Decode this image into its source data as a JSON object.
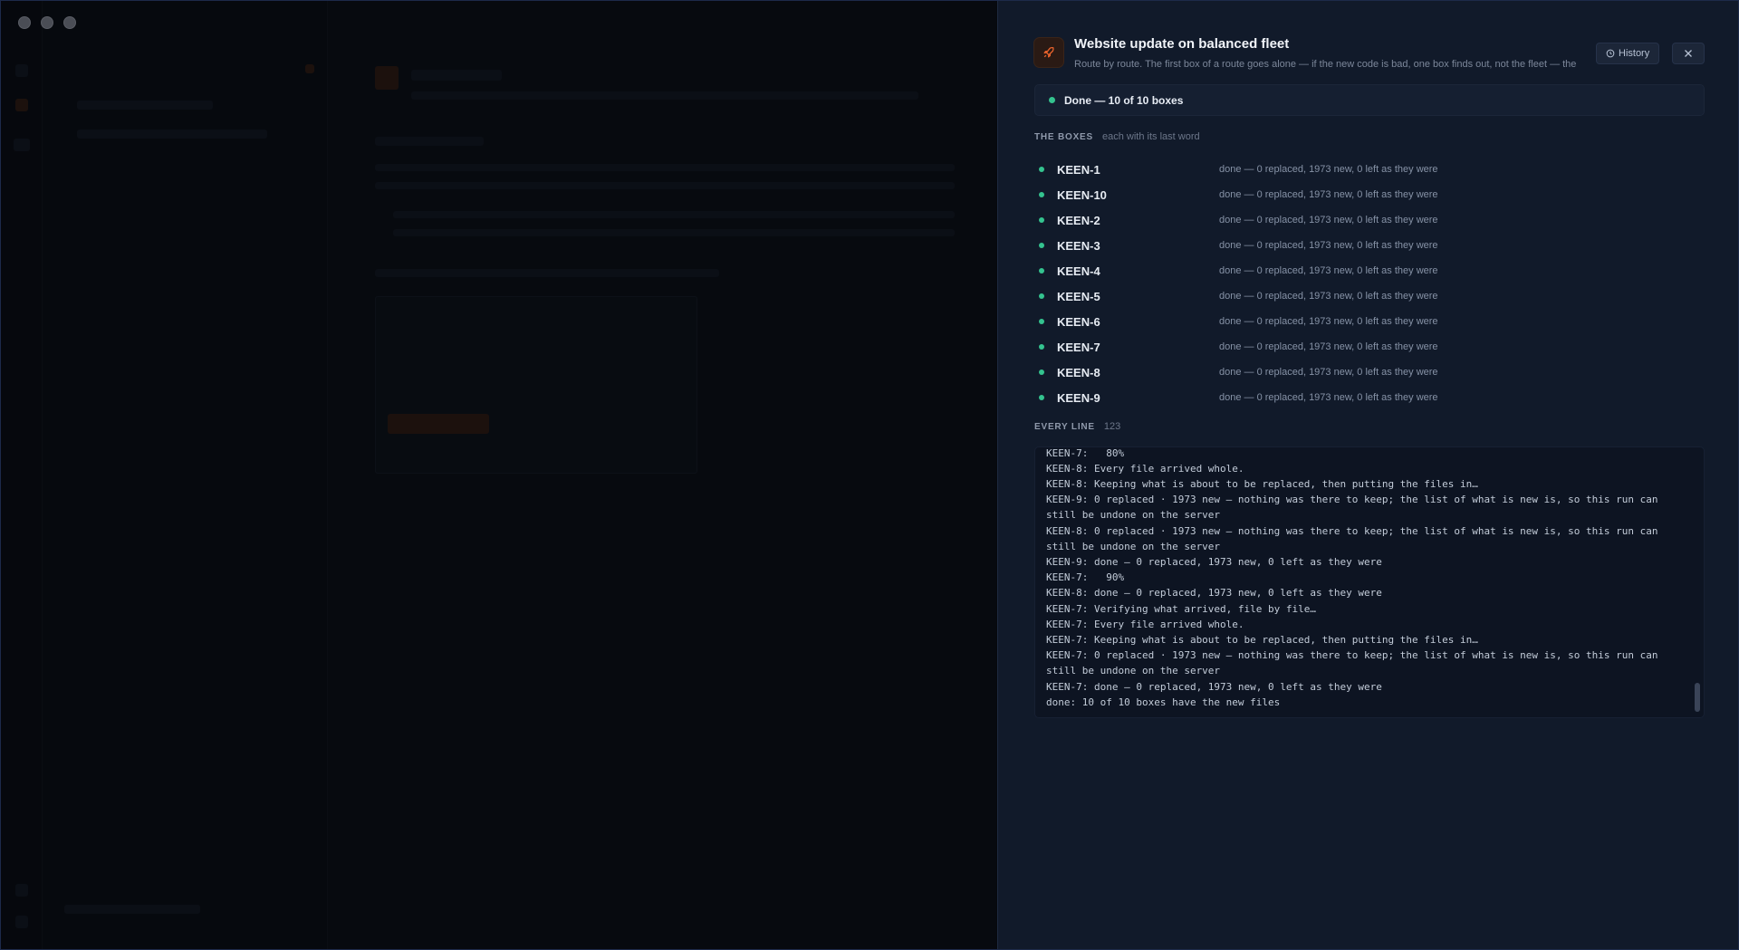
{
  "panel": {
    "title": "Website update on balanced fleet",
    "subtitle": "Route by route. The first box of a route goes alone — if the new code is bad, one box finds out, not the fleet — the",
    "history_label": "History",
    "status": "Done — 10 of 10 boxes",
    "boxes_label": "THE BOXES",
    "boxes_hint": "each with its last word",
    "boxes": [
      {
        "name": "KEEN-1",
        "word": "done — 0 replaced, 1973 new, 0 left as they were"
      },
      {
        "name": "KEEN-10",
        "word": "done — 0 replaced, 1973 new, 0 left as they were"
      },
      {
        "name": "KEEN-2",
        "word": "done — 0 replaced, 1973 new, 0 left as they were"
      },
      {
        "name": "KEEN-3",
        "word": "done — 0 replaced, 1973 new, 0 left as they were"
      },
      {
        "name": "KEEN-4",
        "word": "done — 0 replaced, 1973 new, 0 left as they were"
      },
      {
        "name": "KEEN-5",
        "word": "done — 0 replaced, 1973 new, 0 left as they were"
      },
      {
        "name": "KEEN-6",
        "word": "done — 0 replaced, 1973 new, 0 left as they were"
      },
      {
        "name": "KEEN-7",
        "word": "done — 0 replaced, 1973 new, 0 left as they were"
      },
      {
        "name": "KEEN-8",
        "word": "done — 0 replaced, 1973 new, 0 left as they were"
      },
      {
        "name": "KEEN-9",
        "word": "done — 0 replaced, 1973 new, 0 left as they were"
      }
    ],
    "log_label": "EVERY LINE",
    "log_count": "123",
    "log_lines": [
      "KEEN-7:   80%",
      "KEEN-8: Every file arrived whole.",
      "KEEN-8: Keeping what is about to be replaced, then putting the files in…",
      "KEEN-9: 0 replaced · 1973 new — nothing was there to keep; the list of what is new is, so this run can still be undone on the server",
      "KEEN-8: 0 replaced · 1973 new — nothing was there to keep; the list of what is new is, so this run can still be undone on the server",
      "KEEN-9: done — 0 replaced, 1973 new, 0 left as they were",
      "KEEN-7:   90%",
      "KEEN-8: done — 0 replaced, 1973 new, 0 left as they were",
      "KEEN-7: Verifying what arrived, file by file…",
      "KEEN-7: Every file arrived whole.",
      "KEEN-7: Keeping what is about to be replaced, then putting the files in…",
      "KEEN-7: 0 replaced · 1973 new — nothing was there to keep; the list of what is new is, so this run can still be undone on the server",
      "KEEN-7: done — 0 replaced, 1973 new, 0 left as they were",
      "done: 10 of 10 boxes have the new files"
    ]
  },
  "colors": {
    "panel_bg": "#111a2a",
    "status_ok": "#34c38f",
    "accent_orange": "#e8622c"
  },
  "icons": {
    "app_icon": "rocket-icon",
    "history": "clock-icon",
    "close": "close-icon"
  }
}
